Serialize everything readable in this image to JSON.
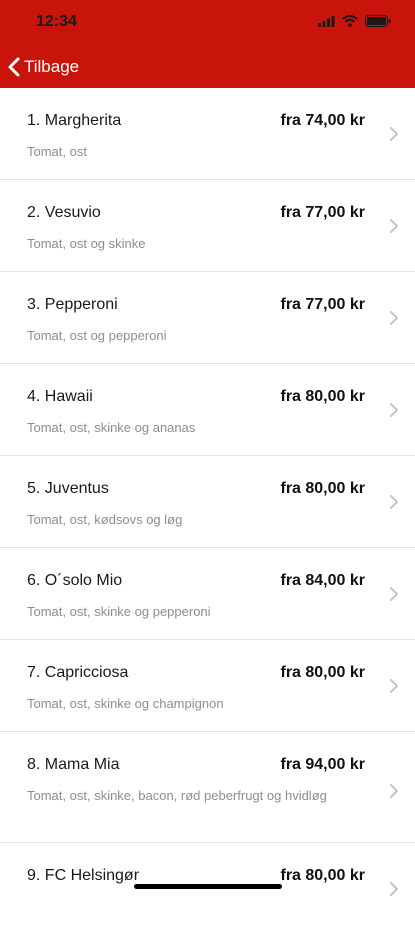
{
  "status_bar": {
    "time": "12:34"
  },
  "nav": {
    "back_label": "Tilbage"
  },
  "menu": {
    "items": [
      {
        "name": "1. Margherita",
        "price": "fra 74,00 kr",
        "description": "Tomat, ost"
      },
      {
        "name": "2. Vesuvio",
        "price": "fra 77,00 kr",
        "description": "Tomat, ost og skinke"
      },
      {
        "name": "3. Pepperoni",
        "price": "fra 77,00 kr",
        "description": "Tomat, ost og pepperoni"
      },
      {
        "name": "4. Hawaii",
        "price": "fra 80,00 kr",
        "description": "Tomat, ost, skinke og ananas"
      },
      {
        "name": "5. Juventus",
        "price": "fra 80,00 kr",
        "description": "Tomat, ost, kødsovs og løg"
      },
      {
        "name": "6. O´solo Mio",
        "price": "fra 84,00 kr",
        "description": "Tomat, ost, skinke og pepperoni"
      },
      {
        "name": "7. Capricciosa",
        "price": "fra 80,00 kr",
        "description": "Tomat, ost, skinke og champignon"
      },
      {
        "name": "8. Mama Mia",
        "price": "fra 94,00 kr",
        "description": "Tomat, ost, skinke, bacon, rød peberfrugt og hvidløg"
      },
      {
        "name": "9. FC Helsingør",
        "price": "fra 80,00 kr",
        "description": ""
      }
    ]
  },
  "colors": {
    "header": "#c8140a",
    "divider": "#e3e3e3",
    "secondary_text": "#8e8e8e",
    "chevron": "#c4c4c8"
  }
}
